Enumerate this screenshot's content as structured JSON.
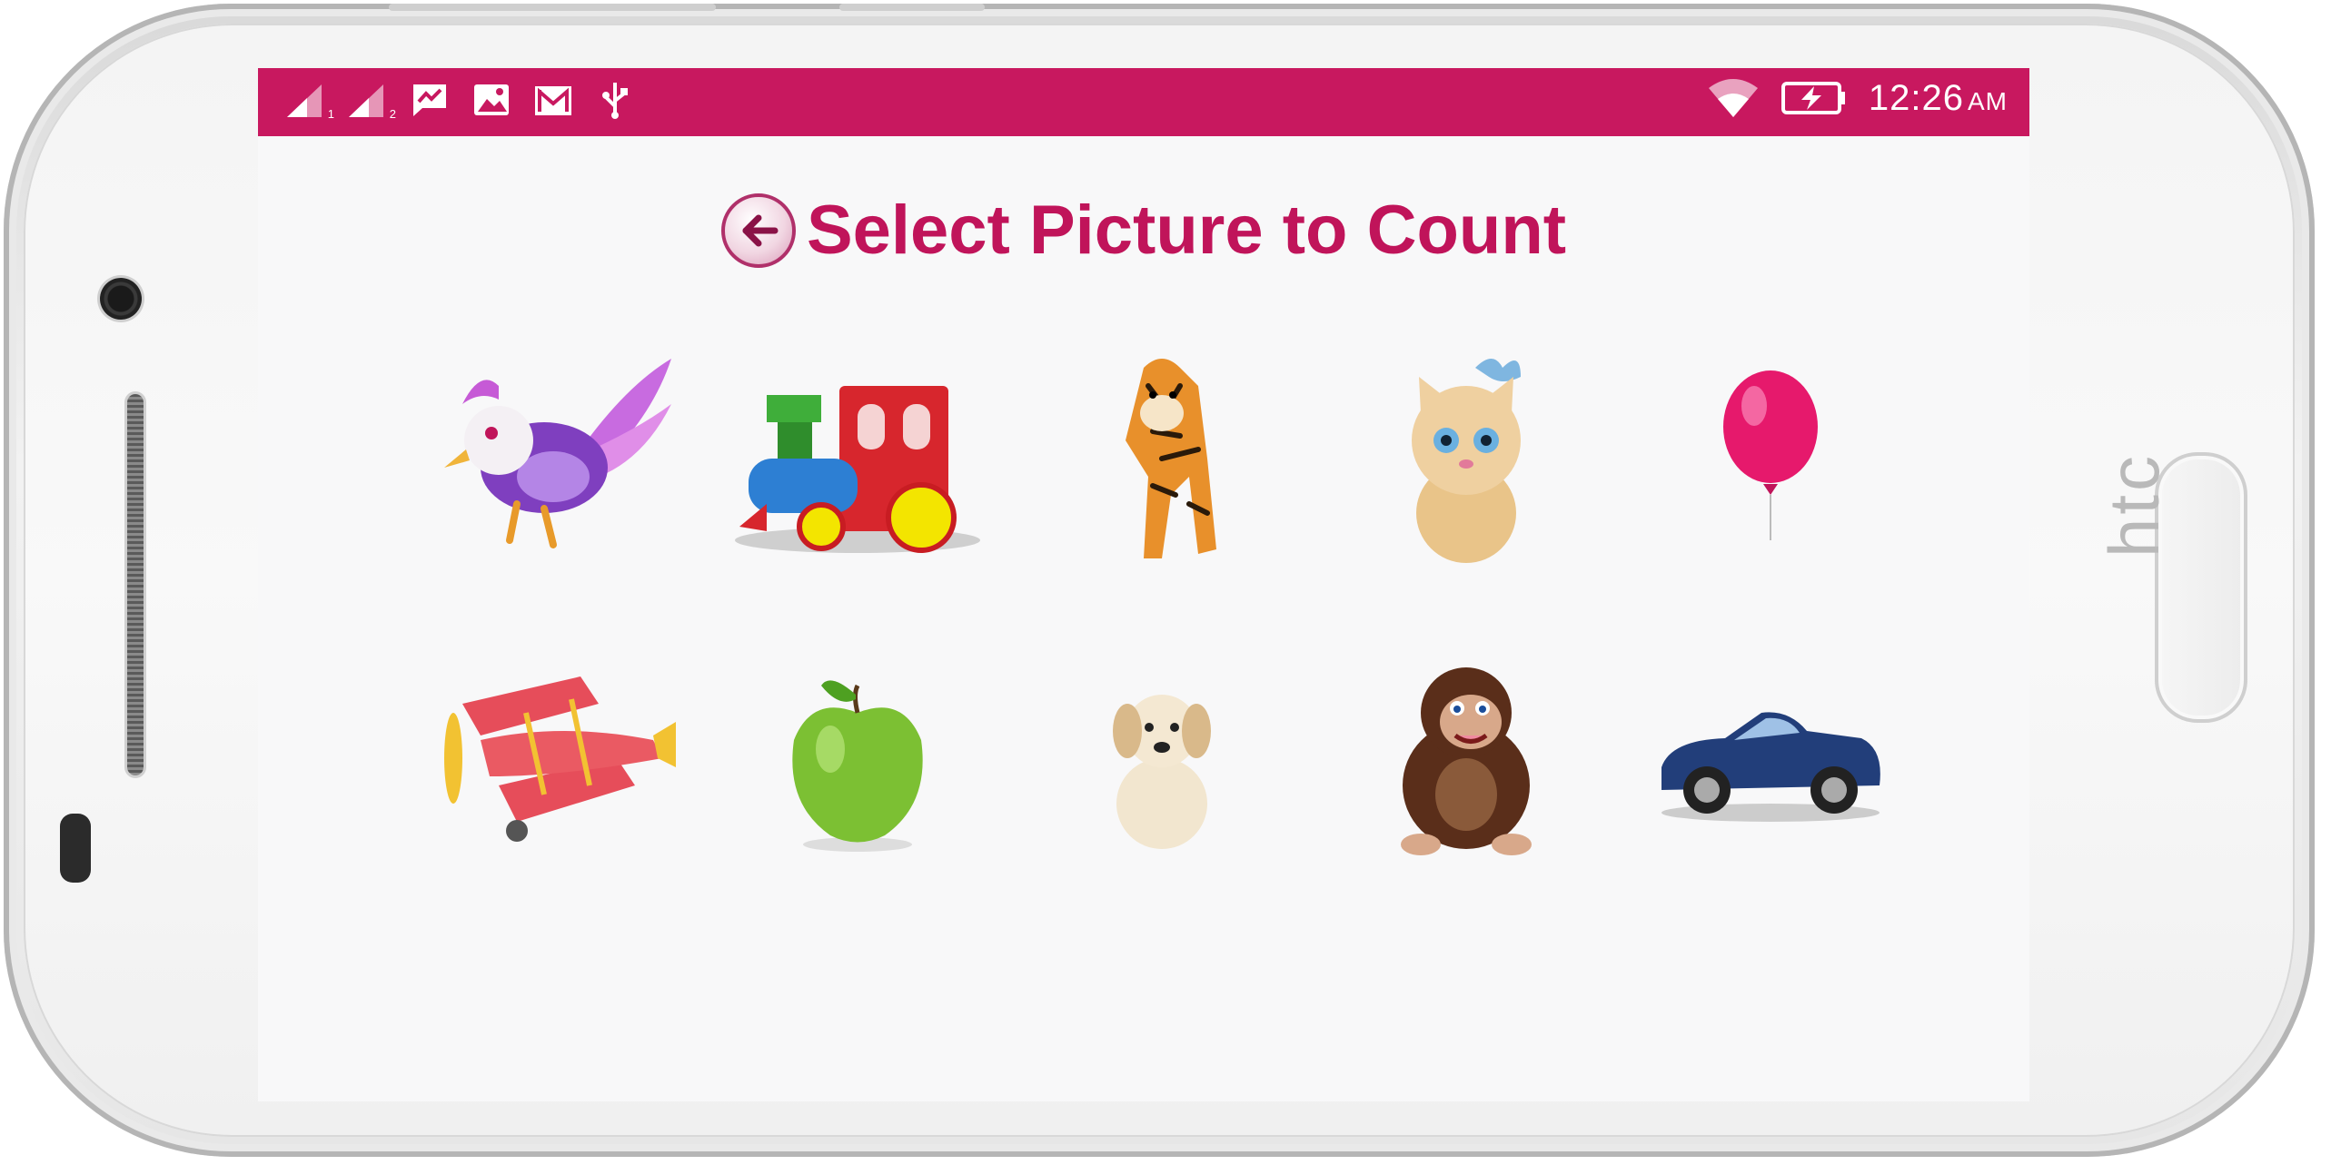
{
  "status_bar": {
    "time": "12:26",
    "ampm": "AM",
    "sim1_label": "1",
    "sim2_label": "2",
    "icons": [
      "signal-sim1-icon",
      "signal-sim2-icon",
      "messenger-icon",
      "gallery-icon",
      "gmail-icon",
      "usb-icon",
      "wifi-icon",
      "battery-charging-icon"
    ],
    "color": "#c8185f"
  },
  "header": {
    "title": "Select Picture to Count",
    "back_icon": "back-arrow-icon",
    "title_color": "#c0145a"
  },
  "pictures": {
    "row1": [
      "bird",
      "train",
      "tiger",
      "kitten",
      "balloon"
    ],
    "row2": [
      "airplane",
      "apple",
      "puppy",
      "gorilla",
      "car"
    ]
  },
  "device": {
    "brand_logo": "htc"
  }
}
